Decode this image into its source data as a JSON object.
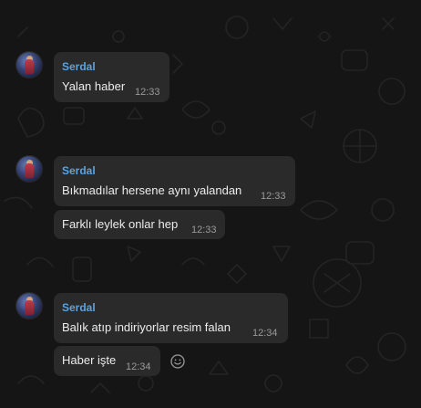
{
  "messages": [
    {
      "sender": "Serdal",
      "text": "Yalan haber",
      "time": "12:33"
    },
    {
      "sender": "Serdal",
      "text": "Bıkmadılar hersene aynı yalandan",
      "time": "12:33"
    },
    {
      "text": "Farklı leylek onlar hep",
      "time": "12:33"
    },
    {
      "sender": "Serdal",
      "text": "Balık atıp indiriyorlar resim falan",
      "time": "12:34"
    },
    {
      "text": "Haber işte",
      "time": "12:34"
    }
  ],
  "colors": {
    "background": "#151515",
    "bubble": "#2a2a2b",
    "sender_name": "#5aa2e2",
    "timestamp": "#9a9a9a"
  },
  "icons": {
    "reaction": "smiley-icon"
  }
}
